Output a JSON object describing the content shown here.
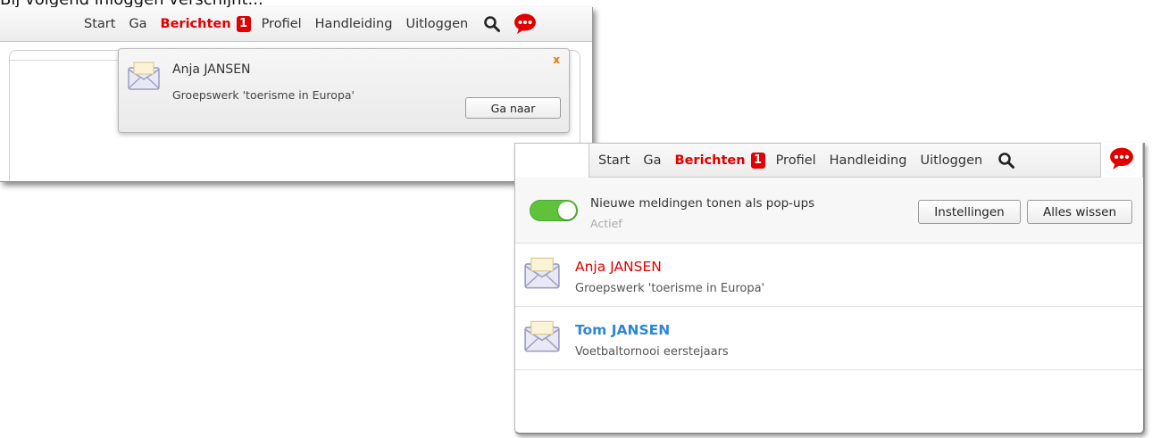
{
  "caption": "Bij volgend inloggen verschijnt...",
  "nav": {
    "items": [
      "Start",
      "Ga"
    ],
    "messages_label": "Berichten",
    "messages_count": "1",
    "items_after": [
      "Profiel",
      "Handleiding",
      "Uitloggen"
    ],
    "icons": {
      "search": "search-icon",
      "chat": "chat-bubble-icon"
    }
  },
  "popup": {
    "sender": "Anja JANSEN",
    "subject": "Groepswerk 'toerisme in Europa'",
    "close": "x",
    "go_button": "Ga naar"
  },
  "panel": {
    "toggle_label": "Nieuwe meldingen tonen als pop-ups",
    "toggle_state": "Actief",
    "toggle_on": true,
    "settings_button": "Instellingen",
    "clear_button": "Alles wissen",
    "messages": [
      {
        "sender": "Anja JANSEN",
        "subject": "Groepswerk 'toerisme in Europa'",
        "unread": true
      },
      {
        "sender": "Tom JANSEN",
        "subject": "Voetbaltornooi eerstejaars",
        "unread": false
      }
    ]
  },
  "colors": {
    "accent": "#e00000",
    "read_link": "#2f86d3",
    "toggle_on": "#5ec33b"
  }
}
